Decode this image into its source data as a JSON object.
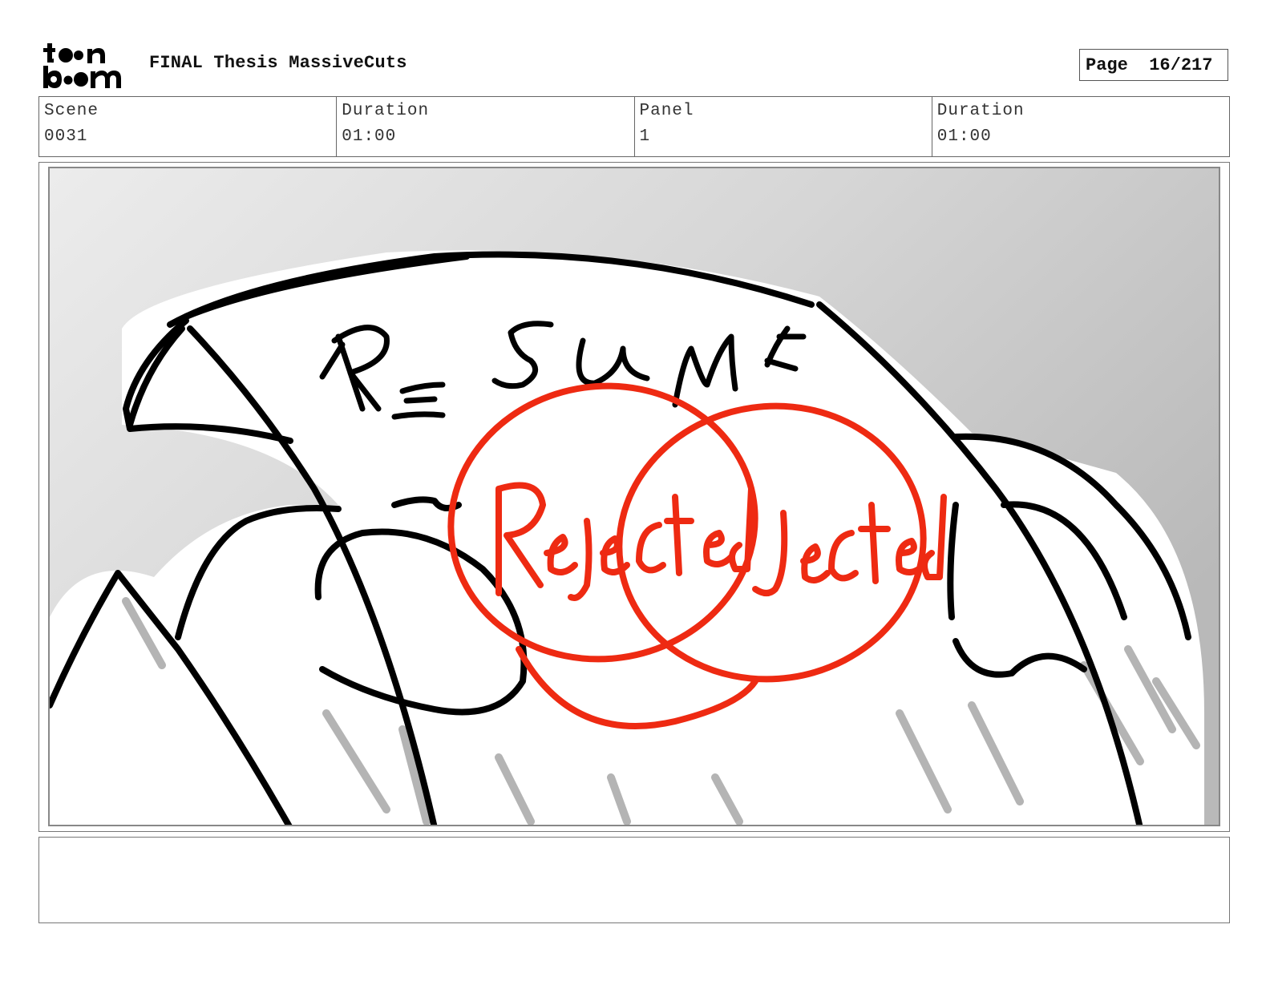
{
  "header": {
    "logo_alt": "toon boom",
    "title": "FINAL Thesis MassiveCuts",
    "page_label": "Page",
    "page_value": "16/217"
  },
  "info": {
    "scene_label": "Scene",
    "scene_value": "0031",
    "duration_label": "Duration",
    "duration_value": "01:00",
    "panel_label": "Panel",
    "panel_value": "1",
    "panel_duration_label": "Duration",
    "panel_duration_value": "01:00"
  },
  "panel": {
    "sketch_text": [
      "RESUME",
      "Rejected",
      "Jected"
    ],
    "colors": {
      "stamp": "#ee2a12",
      "ink": "#000000",
      "background_light": "#ececec",
      "background_dark": "#b9b9b9"
    }
  },
  "notes": {
    "text": ""
  }
}
